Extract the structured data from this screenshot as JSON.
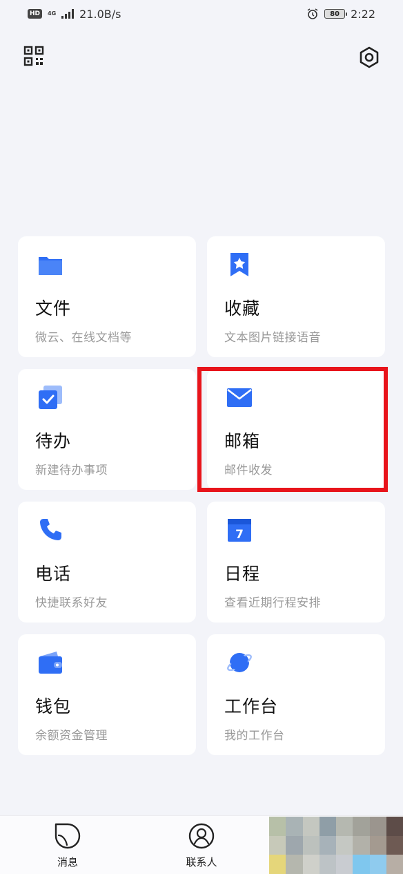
{
  "status_bar": {
    "hd": "HD",
    "network": "4G",
    "speed": "21.0B/s",
    "battery": "80",
    "time": "2:22"
  },
  "toolbar": {
    "qr_icon": "qr-code-icon",
    "settings_icon": "gear-icon"
  },
  "cards": [
    {
      "title": "文件",
      "subtitle": "微云、在线文档等",
      "icon": "folder-icon"
    },
    {
      "title": "收藏",
      "subtitle": "文本图片链接语音",
      "icon": "bookmark-star-icon"
    },
    {
      "title": "待办",
      "subtitle": "新建待办事项",
      "icon": "todo-check-icon"
    },
    {
      "title": "邮箱",
      "subtitle": "邮件收发",
      "icon": "mail-icon"
    },
    {
      "title": "电话",
      "subtitle": "快捷联系好友",
      "icon": "phone-icon"
    },
    {
      "title": "日程",
      "subtitle": "查看近期行程安排",
      "icon": "calendar-icon",
      "calendar_day": "7"
    },
    {
      "title": "钱包",
      "subtitle": "余额资金管理",
      "icon": "wallet-icon"
    },
    {
      "title": "工作台",
      "subtitle": "我的工作台",
      "icon": "planet-icon"
    }
  ],
  "bottom_nav": [
    {
      "label": "消息",
      "icon": "message-icon"
    },
    {
      "label": "联系人",
      "icon": "contacts-icon"
    }
  ],
  "colors": {
    "accent": "#2f6ef5",
    "highlight": "#e8141b",
    "background": "#f3f4f9"
  }
}
